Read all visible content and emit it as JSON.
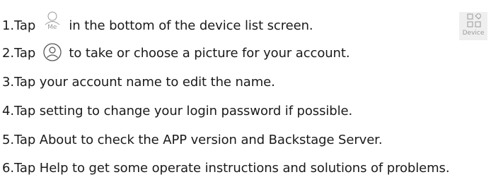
{
  "steps": [
    {
      "before": "1.Tap",
      "after": "in the bottom of the device list screen."
    },
    {
      "before": "2.Tap",
      "after": "to take or choose a picture for your account."
    },
    {
      "text": "3.Tap your account name to edit the name."
    },
    {
      "text": "4.Tap setting to change your login password if possible."
    },
    {
      "text": "5.Tap About to check the APP version and Backstage Server."
    },
    {
      "text": "6.Tap Help to get some operate instructions and solutions of problems."
    }
  ],
  "icons": {
    "me_tab": {
      "name": "me-tab-icon",
      "label": "Me"
    },
    "avatar": {
      "name": "avatar-icon"
    },
    "device_tab": {
      "name": "device-tab-icon",
      "label": "Device"
    }
  },
  "colors": {
    "text": "#1a1a1a",
    "icon_gray": "#9a9a9a",
    "device_bg": "#efefef"
  }
}
